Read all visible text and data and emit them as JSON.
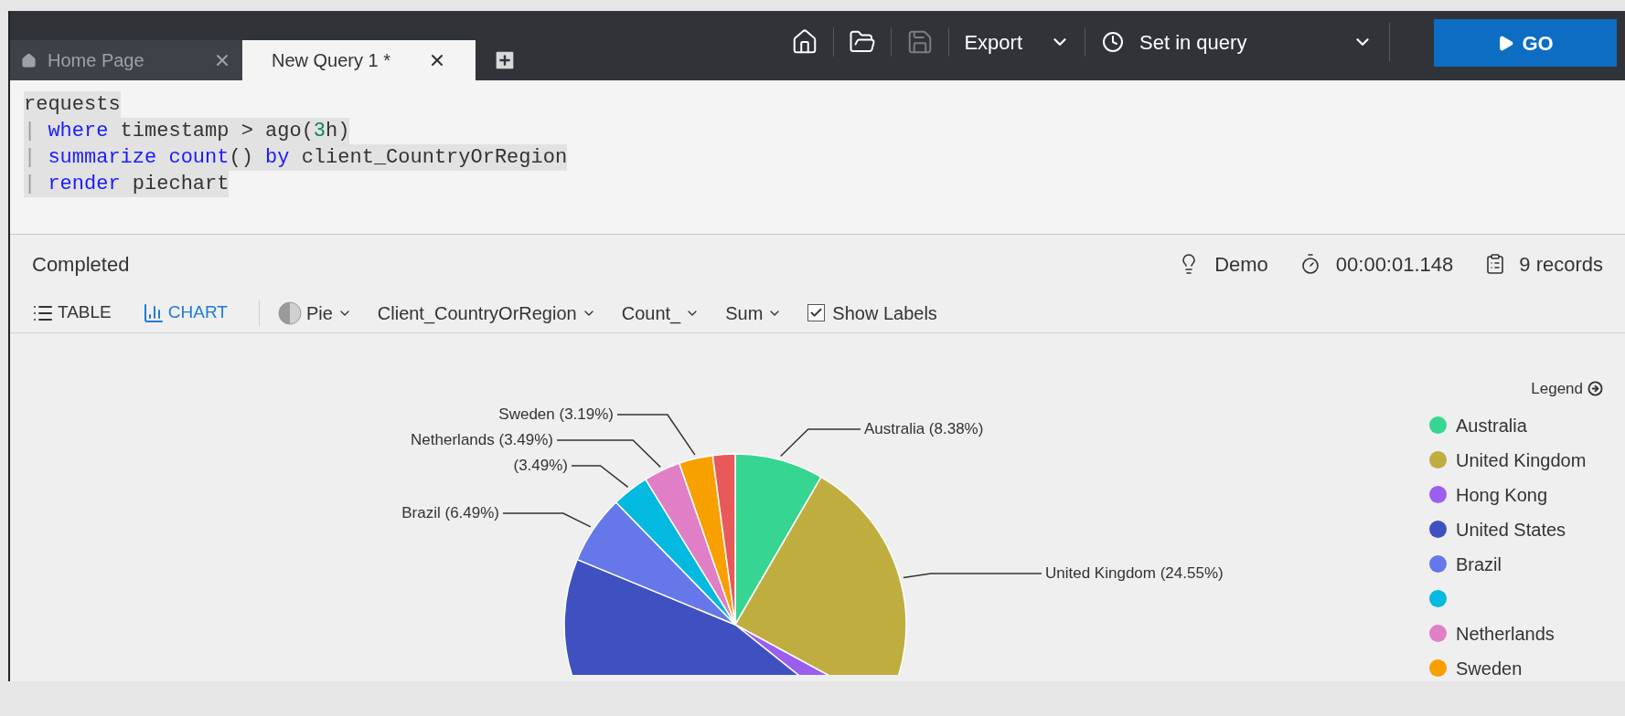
{
  "tabs": [
    {
      "label": "Home Page",
      "selected": false
    },
    {
      "label": "New Query 1 *",
      "selected": true
    }
  ],
  "toolbar": {
    "save_disabled": true,
    "export": "Export",
    "time_range": "Set in query",
    "go": "GO"
  },
  "editor": {
    "lines": [
      {
        "selected": true,
        "tokens": [
          {
            "kind": "plain",
            "text": "requests"
          }
        ]
      },
      {
        "selected": true,
        "tokens": [
          {
            "kind": "pipe",
            "text": "| "
          },
          {
            "kind": "keyword",
            "text": "where"
          },
          {
            "kind": "plain",
            "text": " timestamp > ago("
          },
          {
            "kind": "number",
            "text": "3"
          },
          {
            "kind": "plain",
            "text": "h)"
          }
        ]
      },
      {
        "selected": true,
        "tokens": [
          {
            "kind": "pipe",
            "text": "| "
          },
          {
            "kind": "keyword",
            "text": "summarize "
          },
          {
            "kind": "keyword",
            "text": "count"
          },
          {
            "kind": "plain",
            "text": "() "
          },
          {
            "kind": "keyword",
            "text": "by"
          },
          {
            "kind": "plain",
            "text": " client_CountryOrRegion"
          }
        ]
      },
      {
        "selected": true,
        "tokens": [
          {
            "kind": "pipe",
            "text": "| "
          },
          {
            "kind": "keyword",
            "text": "render"
          },
          {
            "kind": "plain",
            "text": " piechart"
          }
        ]
      }
    ]
  },
  "status": {
    "state": "Completed",
    "database": "Demo",
    "duration": "00:00:01.148",
    "records": "9 records"
  },
  "views": [
    {
      "kind": "table",
      "label": "TABLE",
      "selected": false
    },
    {
      "kind": "chart",
      "label": "CHART",
      "selected": true
    }
  ],
  "chart_options": {
    "type": "Pie",
    "x_column": "Client_CountryOrRegion",
    "y_column": "Count_",
    "aggregation": "Sum",
    "show_labels": {
      "label": "Show Labels",
      "checked": true
    }
  },
  "chart": {
    "chart_data": {
      "type": "pie",
      "values": [
        8.38,
        24.55,
        2.8,
        45.5,
        6.49,
        3.49,
        3.49,
        3.19,
        2.11
      ],
      "colors": [
        "#36d592",
        "#bfad40",
        "#9b5ff0",
        "#3f51c0",
        "#6677ea",
        "#03b9e0",
        "#e07fc6",
        "#f8a000",
        "#e85a5a"
      ],
      "value_labels": [
        "Australia (8.38%)",
        "United Kingdom (24.55%)",
        null,
        null,
        "Brazil (6.49%)",
        "(3.49%)",
        "Netherlands (3.49%)",
        "Sweden (3.19%)",
        null
      ]
    },
    "legend": {
      "title": "Legend",
      "items": [
        {
          "name": "Australia",
          "color": "#36d592"
        },
        {
          "name": "United Kingdom",
          "color": "#bfad40"
        },
        {
          "name": "Hong Kong",
          "color": "#9b5ff0"
        },
        {
          "name": "United States",
          "color": "#3f51c0"
        },
        {
          "name": "Brazil",
          "color": "#6677ea"
        },
        {
          "color": "#03b9e0"
        },
        {
          "name": "Netherlands",
          "color": "#e07fc6"
        },
        {
          "name": "Sweden",
          "color": "#f8a000"
        }
      ]
    }
  }
}
